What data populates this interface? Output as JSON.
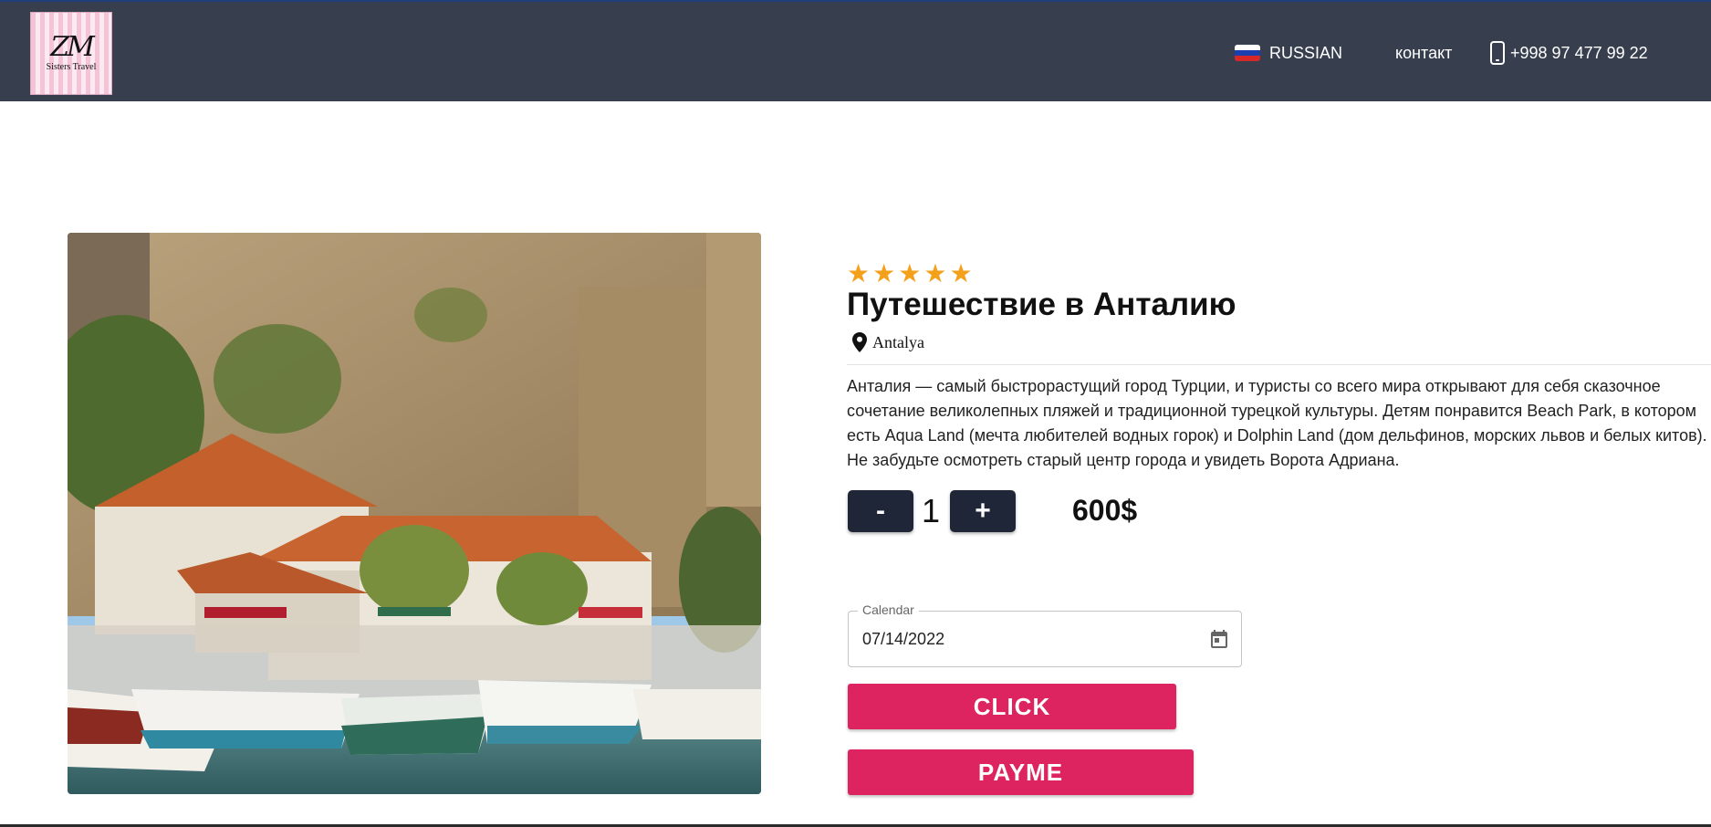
{
  "header": {
    "logo": {
      "monogram": "ZM",
      "text": "Sisters Travel"
    },
    "language": {
      "label": "RUSSIAN",
      "flag_icon": "russia-flag-icon"
    },
    "contact_label": "контакт",
    "phone": {
      "number": "+998 97 477 99 22",
      "icon": "mobile-phone-icon"
    }
  },
  "tour": {
    "rating": 5,
    "stars": [
      "★",
      "★",
      "★",
      "★",
      "★"
    ],
    "title": "Путешествие в Анталию",
    "location": "Antalya",
    "description": "Анталия — самый быстрорастущий город Турции, и туристы со всего мира открывают для себя сказочное сочетание великолепных пляжей и традиционной турецкой культуры. Детям понравится Beach Park, в котором есть Aqua Land (мечта любителей водных горок) и Dolphin Land (дом дельфинов, морских львов и белых китов). Не забудьте осмотреть старый центр города и увидеть Ворота Адриана.",
    "quantity": {
      "minus_label": "-",
      "value": "1",
      "plus_label": "+"
    },
    "price": "600$"
  },
  "booking": {
    "calendar_label": "Calendar",
    "date_value": "07/14/2022",
    "calendar_icon": "calendar-icon",
    "click_label": "CLICK",
    "payme_label": "PAYME"
  },
  "colors": {
    "header_bg": "#373f4f",
    "star": "#f5a01a",
    "qty_button": "#1f2637",
    "pay_button": "#de2361"
  }
}
